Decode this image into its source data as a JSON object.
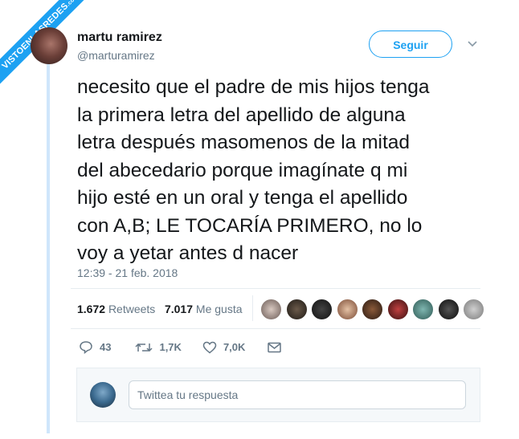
{
  "watermark": {
    "main": "VISTOENLASREDES",
    "sub": ".com"
  },
  "author": {
    "name": "martu ramirez",
    "handle": "@marturamirez"
  },
  "follow_label": "Seguir",
  "tweet_lines": [
    "necesito que el padre de mis hijos tenga",
    "la primera letra del apellido de alguna",
    "letra después masomenos de la mitad",
    "del abecedario porque imagínate q mi",
    "hijo esté en un oral y tenga el apellido",
    "con A,B; LE TOCARÍA PRIMERO, no lo",
    "voy a yetar antes d nacer"
  ],
  "timestamp": "12:39 - 21 feb. 2018",
  "stats": {
    "retweets_count": "1.672",
    "retweets_label": "Retweets",
    "likes_count": "7.017",
    "likes_label": "Me gusta"
  },
  "actions": {
    "replies": "43",
    "retweets": "1,7K",
    "likes": "7,0K"
  },
  "reply_placeholder": "Twittea tu respuesta",
  "colors": {
    "accent": "#1da1f2",
    "muted": "#657786",
    "text": "#14171a"
  }
}
